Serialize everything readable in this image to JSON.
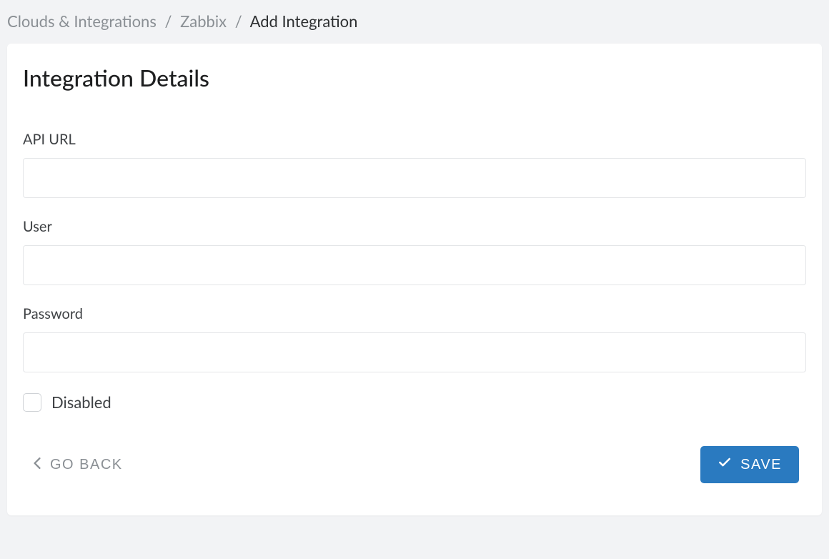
{
  "breadcrumb": {
    "items": [
      {
        "label": "Clouds & Integrations",
        "current": false
      },
      {
        "label": "Zabbix",
        "current": false
      },
      {
        "label": "Add Integration",
        "current": true
      }
    ],
    "separator": "/"
  },
  "card": {
    "title": "Integration Details"
  },
  "form": {
    "api_url": {
      "label": "API URL",
      "value": ""
    },
    "user": {
      "label": "User",
      "value": ""
    },
    "password": {
      "label": "Password",
      "value": ""
    },
    "disabled": {
      "label": "Disabled",
      "checked": false
    }
  },
  "actions": {
    "back_label": "GO BACK",
    "save_label": "SAVE"
  }
}
